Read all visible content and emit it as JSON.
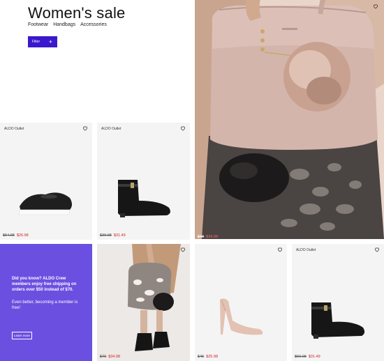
{
  "header": {
    "title": "Women's sale",
    "nav": [
      "Footwear",
      "Handbags",
      "Accessories"
    ],
    "filter_label": "Filter"
  },
  "products": [
    {
      "brand": "ALDO Outlet",
      "old_price": "$54.98",
      "new_price": "$26.98"
    },
    {
      "brand": "ALDO Outlet",
      "old_price": "$39.98",
      "new_price": "$31.49"
    },
    {
      "brand": "",
      "old_price": "$70",
      "new_price": "$34.98"
    },
    {
      "brand": "",
      "old_price": "$70",
      "new_price": "$34.98"
    },
    {
      "brand": "",
      "old_price": "$45",
      "new_price": "$25.98"
    },
    {
      "brand": "ALDO Outlet",
      "old_price": "$59.98",
      "new_price": "$31.49"
    }
  ],
  "promo": {
    "headline": "Did you know? ALDO Crew members enjoy free shipping on orders over $50 instead of $70.",
    "body": "Even better, becoming a member is free!",
    "button": "Learn more"
  },
  "colors": {
    "accent": "#3b18cc",
    "promo_bg": "#6b4fe0",
    "sale_price": "#d0202a"
  },
  "icons": [
    "heart-icon",
    "plus-icon"
  ]
}
